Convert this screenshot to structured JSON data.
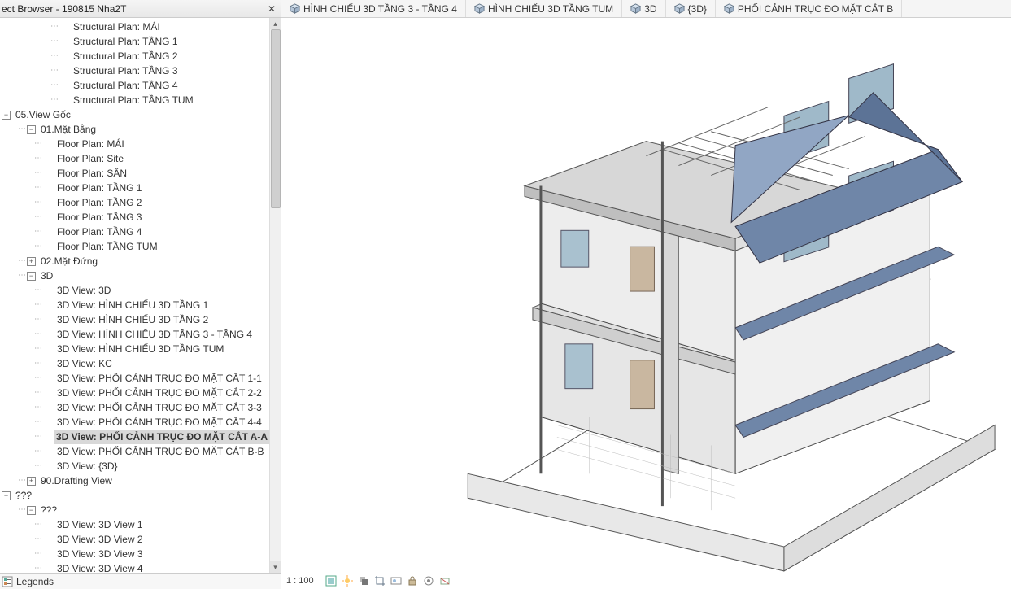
{
  "panel": {
    "title": "ect Browser - 190815 Nha2T",
    "footer_label": "Legends"
  },
  "tabs": [
    {
      "label": "HÌNH CHIẾU 3D TẦNG 3 - TẦNG 4"
    },
    {
      "label": "HÌNH CHIẾU 3D TẦNG TUM"
    },
    {
      "label": "3D"
    },
    {
      "label": "{3D}"
    },
    {
      "label": "PHỐI CẢNH TRỤC ĐO MẶT CẮT B"
    }
  ],
  "tree": [
    {
      "indent": 3,
      "exp": "",
      "label": "Structural Plan: MÁI"
    },
    {
      "indent": 3,
      "exp": "",
      "label": "Structural Plan: TẦNG 1"
    },
    {
      "indent": 3,
      "exp": "",
      "label": "Structural Plan: TẦNG 2"
    },
    {
      "indent": 3,
      "exp": "",
      "label": "Structural Plan: TẦNG 3"
    },
    {
      "indent": 3,
      "exp": "",
      "label": "Structural Plan: TẦNG 4"
    },
    {
      "indent": 3,
      "exp": "",
      "label": "Structural Plan: TẦNG  TUM"
    },
    {
      "indent": 0,
      "exp": "-",
      "label": "05.View Gốc"
    },
    {
      "indent": 1,
      "exp": "-",
      "label": "01.Mặt Bằng"
    },
    {
      "indent": 2,
      "exp": "",
      "label": "Floor Plan: MÁI"
    },
    {
      "indent": 2,
      "exp": "",
      "label": "Floor Plan: Site"
    },
    {
      "indent": 2,
      "exp": "",
      "label": "Floor Plan: SÂN"
    },
    {
      "indent": 2,
      "exp": "",
      "label": "Floor Plan: TẦNG 1"
    },
    {
      "indent": 2,
      "exp": "",
      "label": "Floor Plan: TẦNG 2"
    },
    {
      "indent": 2,
      "exp": "",
      "label": "Floor Plan: TẦNG 3"
    },
    {
      "indent": 2,
      "exp": "",
      "label": "Floor Plan: TẦNG 4"
    },
    {
      "indent": 2,
      "exp": "",
      "label": "Floor Plan: TẦNG  TUM"
    },
    {
      "indent": 1,
      "exp": "+",
      "label": "02.Mặt Đứng"
    },
    {
      "indent": 1,
      "exp": "-",
      "label": "3D"
    },
    {
      "indent": 2,
      "exp": "",
      "label": "3D View: 3D"
    },
    {
      "indent": 2,
      "exp": "",
      "label": "3D View: HÌNH CHIẾU 3D TẦNG 1"
    },
    {
      "indent": 2,
      "exp": "",
      "label": "3D View: HÌNH CHIẾU 3D TẦNG 2"
    },
    {
      "indent": 2,
      "exp": "",
      "label": "3D View: HÌNH CHIẾU 3D TẦNG 3 - TẦNG 4"
    },
    {
      "indent": 2,
      "exp": "",
      "label": "3D View: HÌNH CHIẾU 3D TẦNG TUM"
    },
    {
      "indent": 2,
      "exp": "",
      "label": "3D View: KC"
    },
    {
      "indent": 2,
      "exp": "",
      "label": "3D View: PHỐI CẢNH TRỤC ĐO MẶT CẮT 1-1"
    },
    {
      "indent": 2,
      "exp": "",
      "label": "3D View: PHỐI CẢNH TRỤC ĐO MẶT CẮT 2-2"
    },
    {
      "indent": 2,
      "exp": "",
      "label": "3D View: PHỐI CẢNH TRỤC ĐO MẶT CẮT 3-3"
    },
    {
      "indent": 2,
      "exp": "",
      "label": "3D View: PHỐI CẢNH TRỤC ĐO MẶT CẮT 4-4"
    },
    {
      "indent": 2,
      "exp": "",
      "label": "3D View: PHỐI CẢNH TRỤC ĐO MẶT CẮT A-A",
      "selected": true
    },
    {
      "indent": 2,
      "exp": "",
      "label": "3D View: PHỐI CẢNH TRỤC ĐO MẶT CẮT B-B"
    },
    {
      "indent": 2,
      "exp": "",
      "label": "3D View: {3D}"
    },
    {
      "indent": 1,
      "exp": "+",
      "label": "90.Drafting View"
    },
    {
      "indent": 0,
      "exp": "-",
      "label": "???"
    },
    {
      "indent": 1,
      "exp": "-",
      "label": "???"
    },
    {
      "indent": 2,
      "exp": "",
      "label": "3D View: 3D View 1"
    },
    {
      "indent": 2,
      "exp": "",
      "label": "3D View: 3D View 2"
    },
    {
      "indent": 2,
      "exp": "",
      "label": "3D View: 3D View 3"
    },
    {
      "indent": 2,
      "exp": "",
      "label": "3D View: 3D View 4"
    }
  ],
  "viewport": {
    "scale_label": "1 : 100"
  }
}
